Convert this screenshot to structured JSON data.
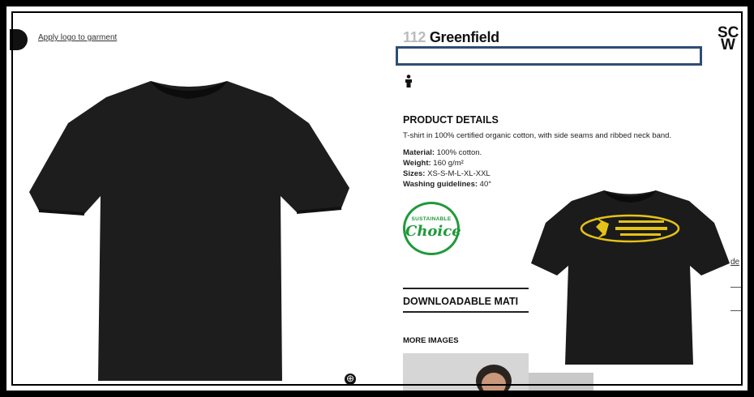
{
  "apply_logo_link": "Apply logo to garment",
  "product": {
    "number": "112",
    "name": "Greenfield"
  },
  "brand_partial": [
    "SC",
    "W"
  ],
  "product_details": {
    "heading": "PRODUCT DETAILS",
    "description": "T-shirt in 100% certified organic cotton, with side seams and ribbed neck band.",
    "specs": [
      {
        "label": "Material:",
        "value": " 100% cotton."
      },
      {
        "label": "Weight:",
        "value": " 160 g/m²"
      },
      {
        "label": "Sizes:",
        "value": " XS-S-M-L-XL-XXL"
      },
      {
        "label": "Washing guidelines:",
        "value": " 40°"
      }
    ]
  },
  "badge": {
    "top": "SUSTAINABLE",
    "main": "Choice"
  },
  "downloadable_heading": "DOWNLOADABLE MATI",
  "more_images_heading": "MORE IMAGES",
  "right_link_partial": "de",
  "colors": {
    "accent_box": "#2e4d72",
    "badge_green": "#1f9a3a",
    "logo_yellow": "#e5c219"
  },
  "icons": [
    "person-icon",
    "zoom-in-icon"
  ]
}
